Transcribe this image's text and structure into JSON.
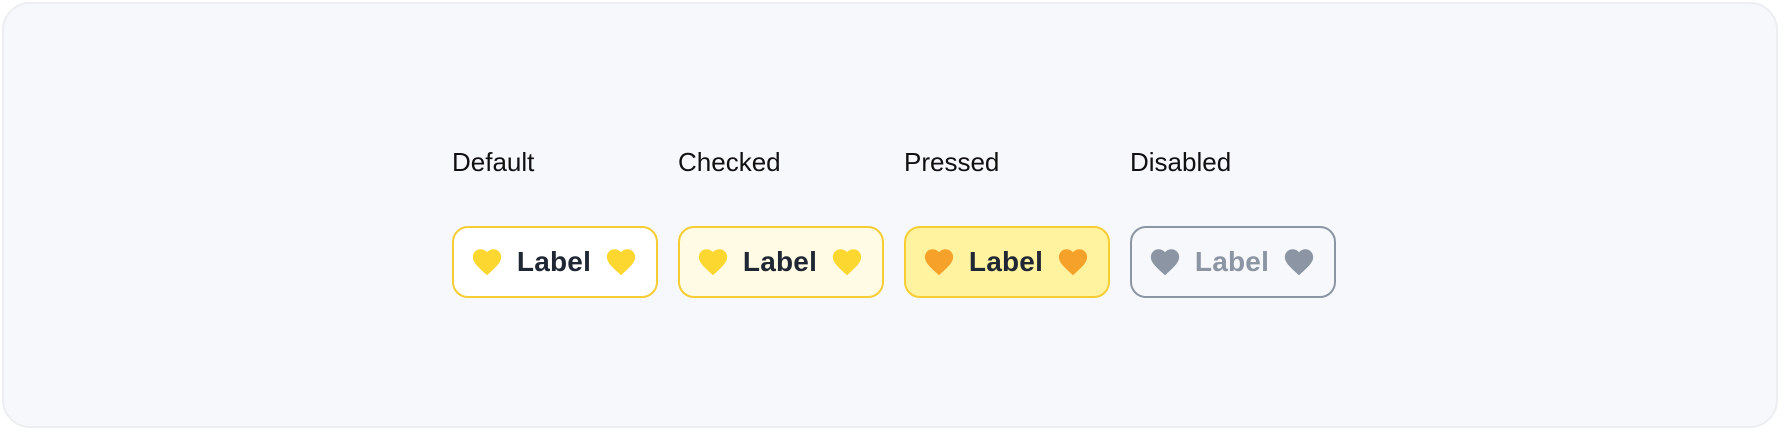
{
  "states": [
    {
      "name": "Default",
      "chip_label": "Label",
      "leading_icon": "heart-icon",
      "trailing_icon": "heart-icon",
      "icon_color": "#fcd730",
      "background": "#ffffff",
      "border": "#f7cd34"
    },
    {
      "name": "Checked",
      "chip_label": "Label",
      "leading_icon": "heart-icon",
      "trailing_icon": "heart-icon",
      "icon_color": "#fcd730",
      "background": "#fffbe5",
      "border": "#f7cd34"
    },
    {
      "name": "Pressed",
      "chip_label": "Label",
      "leading_icon": "heart-icon",
      "trailing_icon": "heart-icon",
      "icon_color": "#f6a22a",
      "background": "#fff3a0",
      "border": "#f7cd34"
    },
    {
      "name": "Disabled",
      "chip_label": "Label",
      "leading_icon": "heart-icon",
      "trailing_icon": "heart-icon",
      "icon_color": "#8b95a3",
      "background": "#f7f8fb",
      "border": "#8b95a3"
    }
  ]
}
